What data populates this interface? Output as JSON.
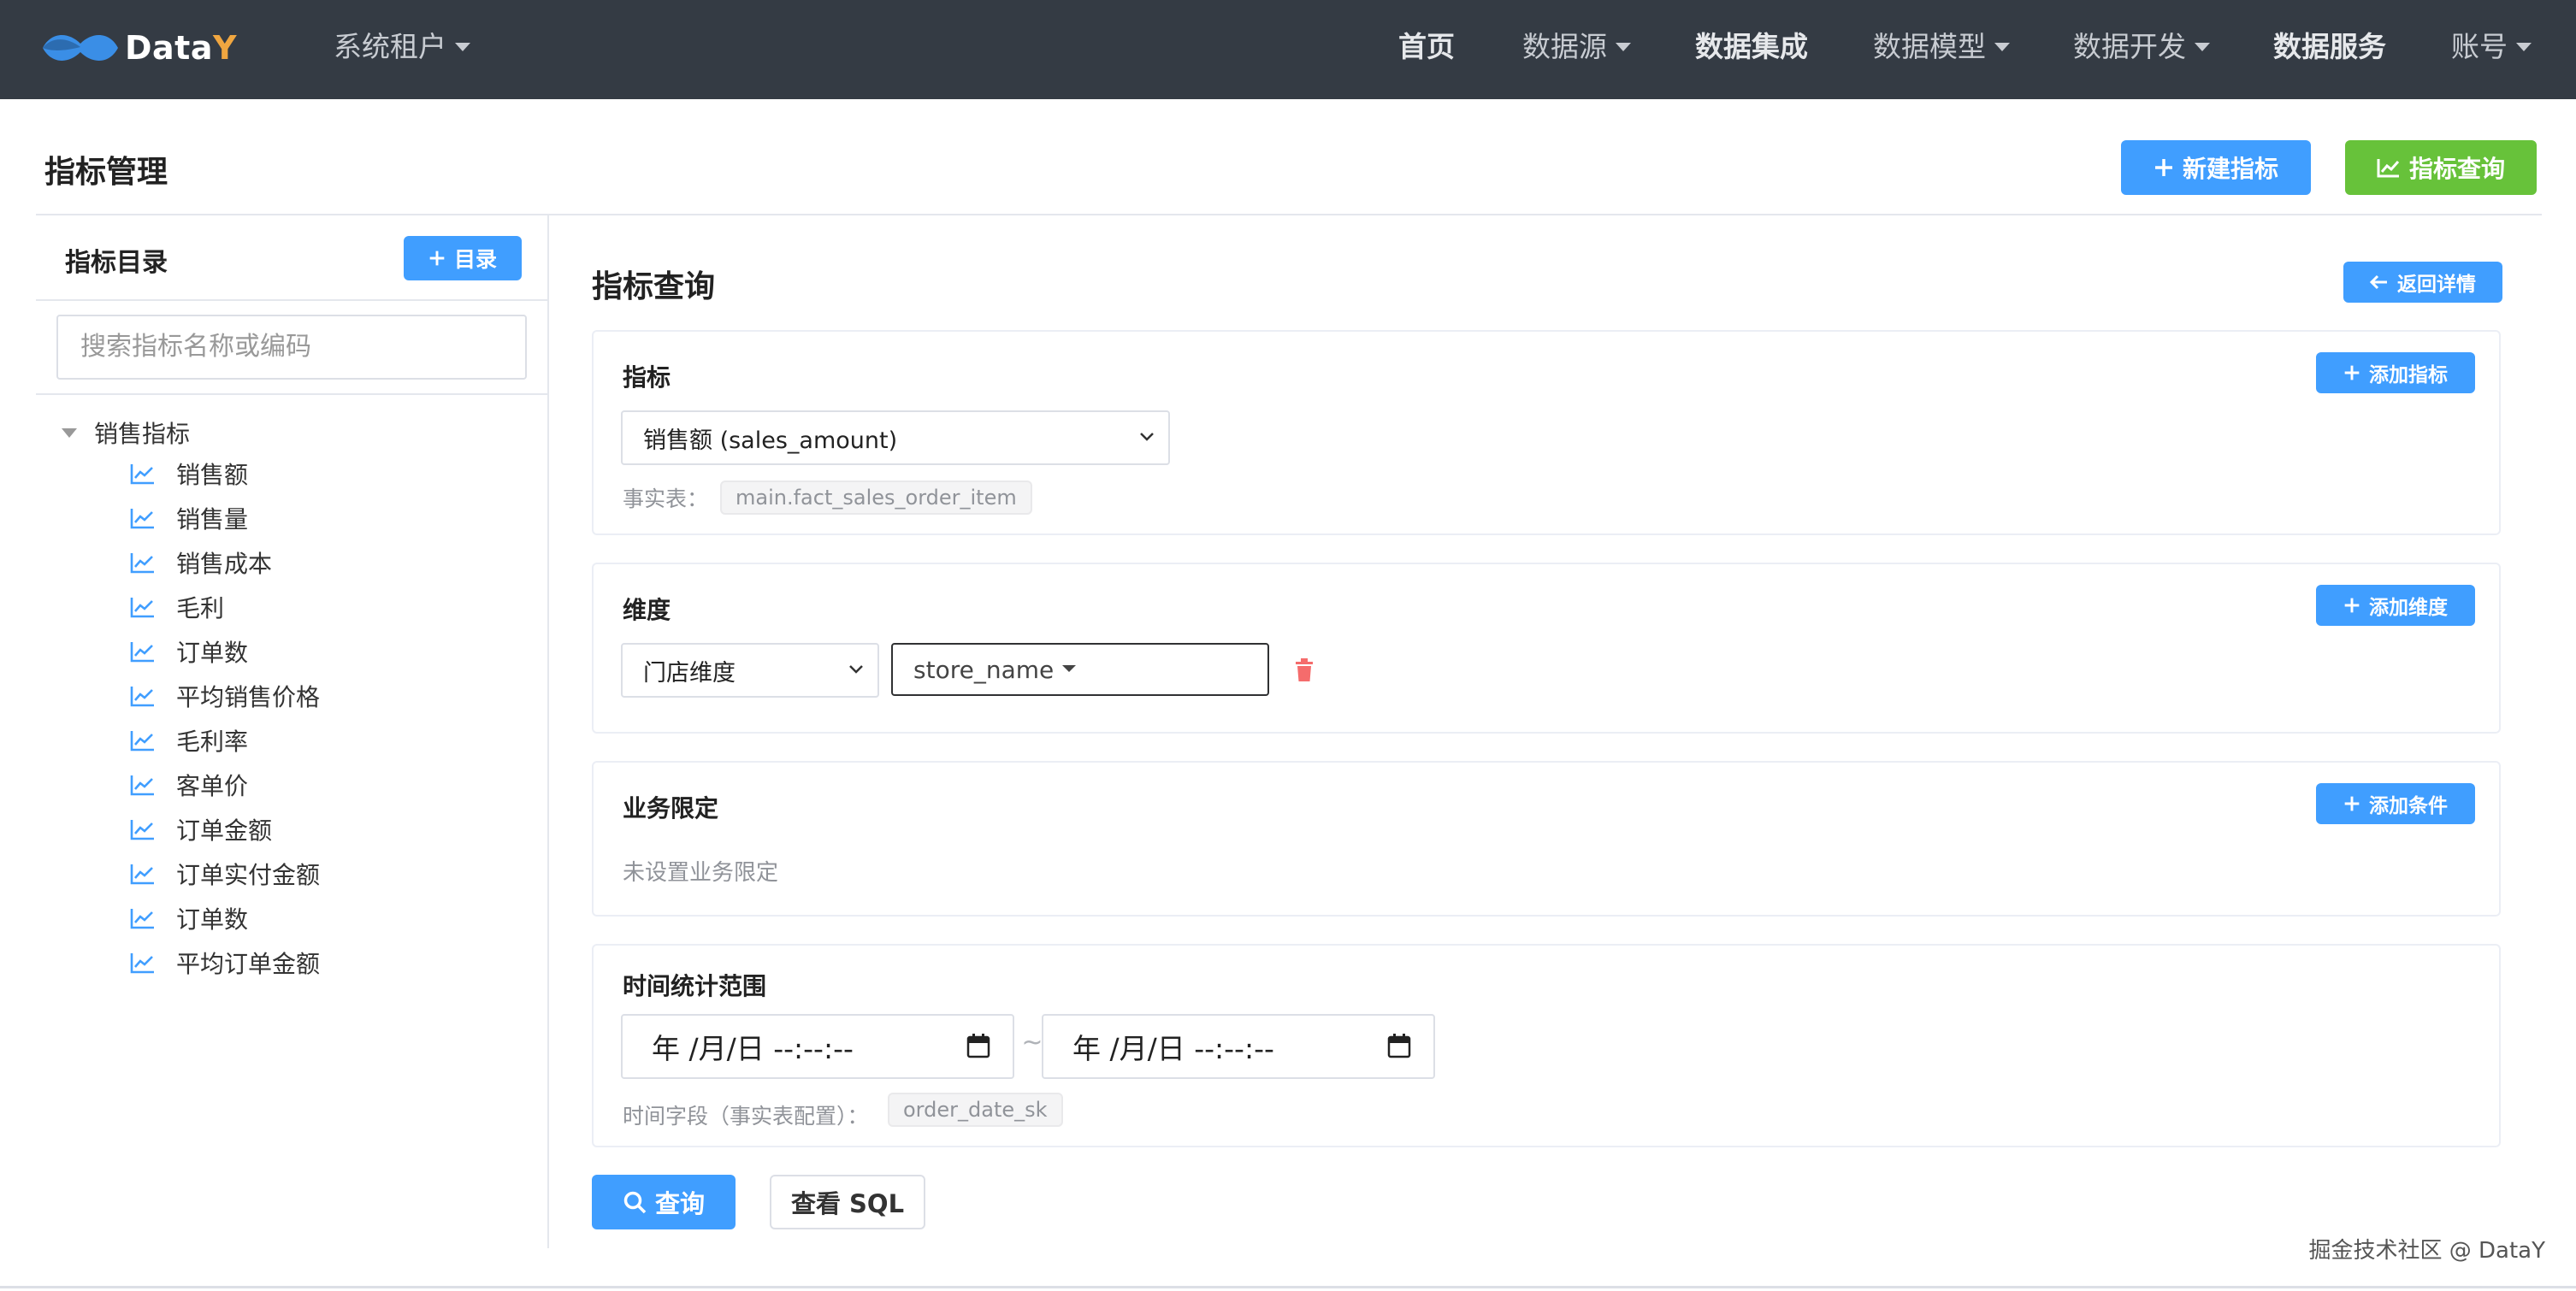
{
  "app": {
    "logo_text": "Data",
    "logo_suffix": "Y"
  },
  "nav": {
    "tenant": "系统租户",
    "items": [
      {
        "label": "首页"
      },
      {
        "label": "数据源"
      },
      {
        "label": "数据集成"
      },
      {
        "label": "数据模型"
      },
      {
        "label": "数据开发"
      },
      {
        "label": "数据服务"
      },
      {
        "label": "账号"
      }
    ]
  },
  "page": {
    "title": "指标管理",
    "new_metric_button": "新建指标",
    "metric_query_button": "指标查询"
  },
  "sidebar": {
    "title": "指标目录",
    "add_catalog_button": "目录",
    "search_placeholder": "搜索指标名称或编码",
    "tree_root": "销售指标",
    "items": [
      {
        "label": "销售额"
      },
      {
        "label": "销售量"
      },
      {
        "label": "销售成本"
      },
      {
        "label": "毛利"
      },
      {
        "label": "订单数"
      },
      {
        "label": "平均销售价格"
      },
      {
        "label": "毛利率"
      },
      {
        "label": "客单价"
      },
      {
        "label": "订单金额"
      },
      {
        "label": "订单实付金额"
      },
      {
        "label": "订单数"
      },
      {
        "label": "平均订单金额"
      }
    ]
  },
  "main": {
    "title": "指标查询",
    "back_button": "返回详情",
    "metric_card": {
      "title": "指标",
      "add_button": "添加指标",
      "selected_metric": "销售额 (sales_amount)",
      "fact_table_label": "事实表：",
      "fact_table_value": "main.fact_sales_order_item"
    },
    "dimension_card": {
      "title": "维度",
      "add_button": "添加维度",
      "selected_dimension": "门店维度",
      "selected_field": "store_name"
    },
    "business_card": {
      "title": "业务限定",
      "add_button": "添加条件",
      "empty_text": "未设置业务限定"
    },
    "time_card": {
      "title": "时间统计范围",
      "start_placeholder": "年 /月/日 --:--:--",
      "separator": "~",
      "end_placeholder": "年 /月/日 --:--:--",
      "time_field_label": "时间字段（事实表配置）：",
      "time_field_value": "order_date_sk"
    },
    "query_button": "查询",
    "view_sql_button": "查看 SQL"
  },
  "footer": {
    "watermark": "掘金技术社区 @ DataY"
  },
  "colors": {
    "navbar_bg": "#343b44",
    "primary": "#409eff",
    "success": "#67c23a",
    "danger": "#f56c6c"
  }
}
